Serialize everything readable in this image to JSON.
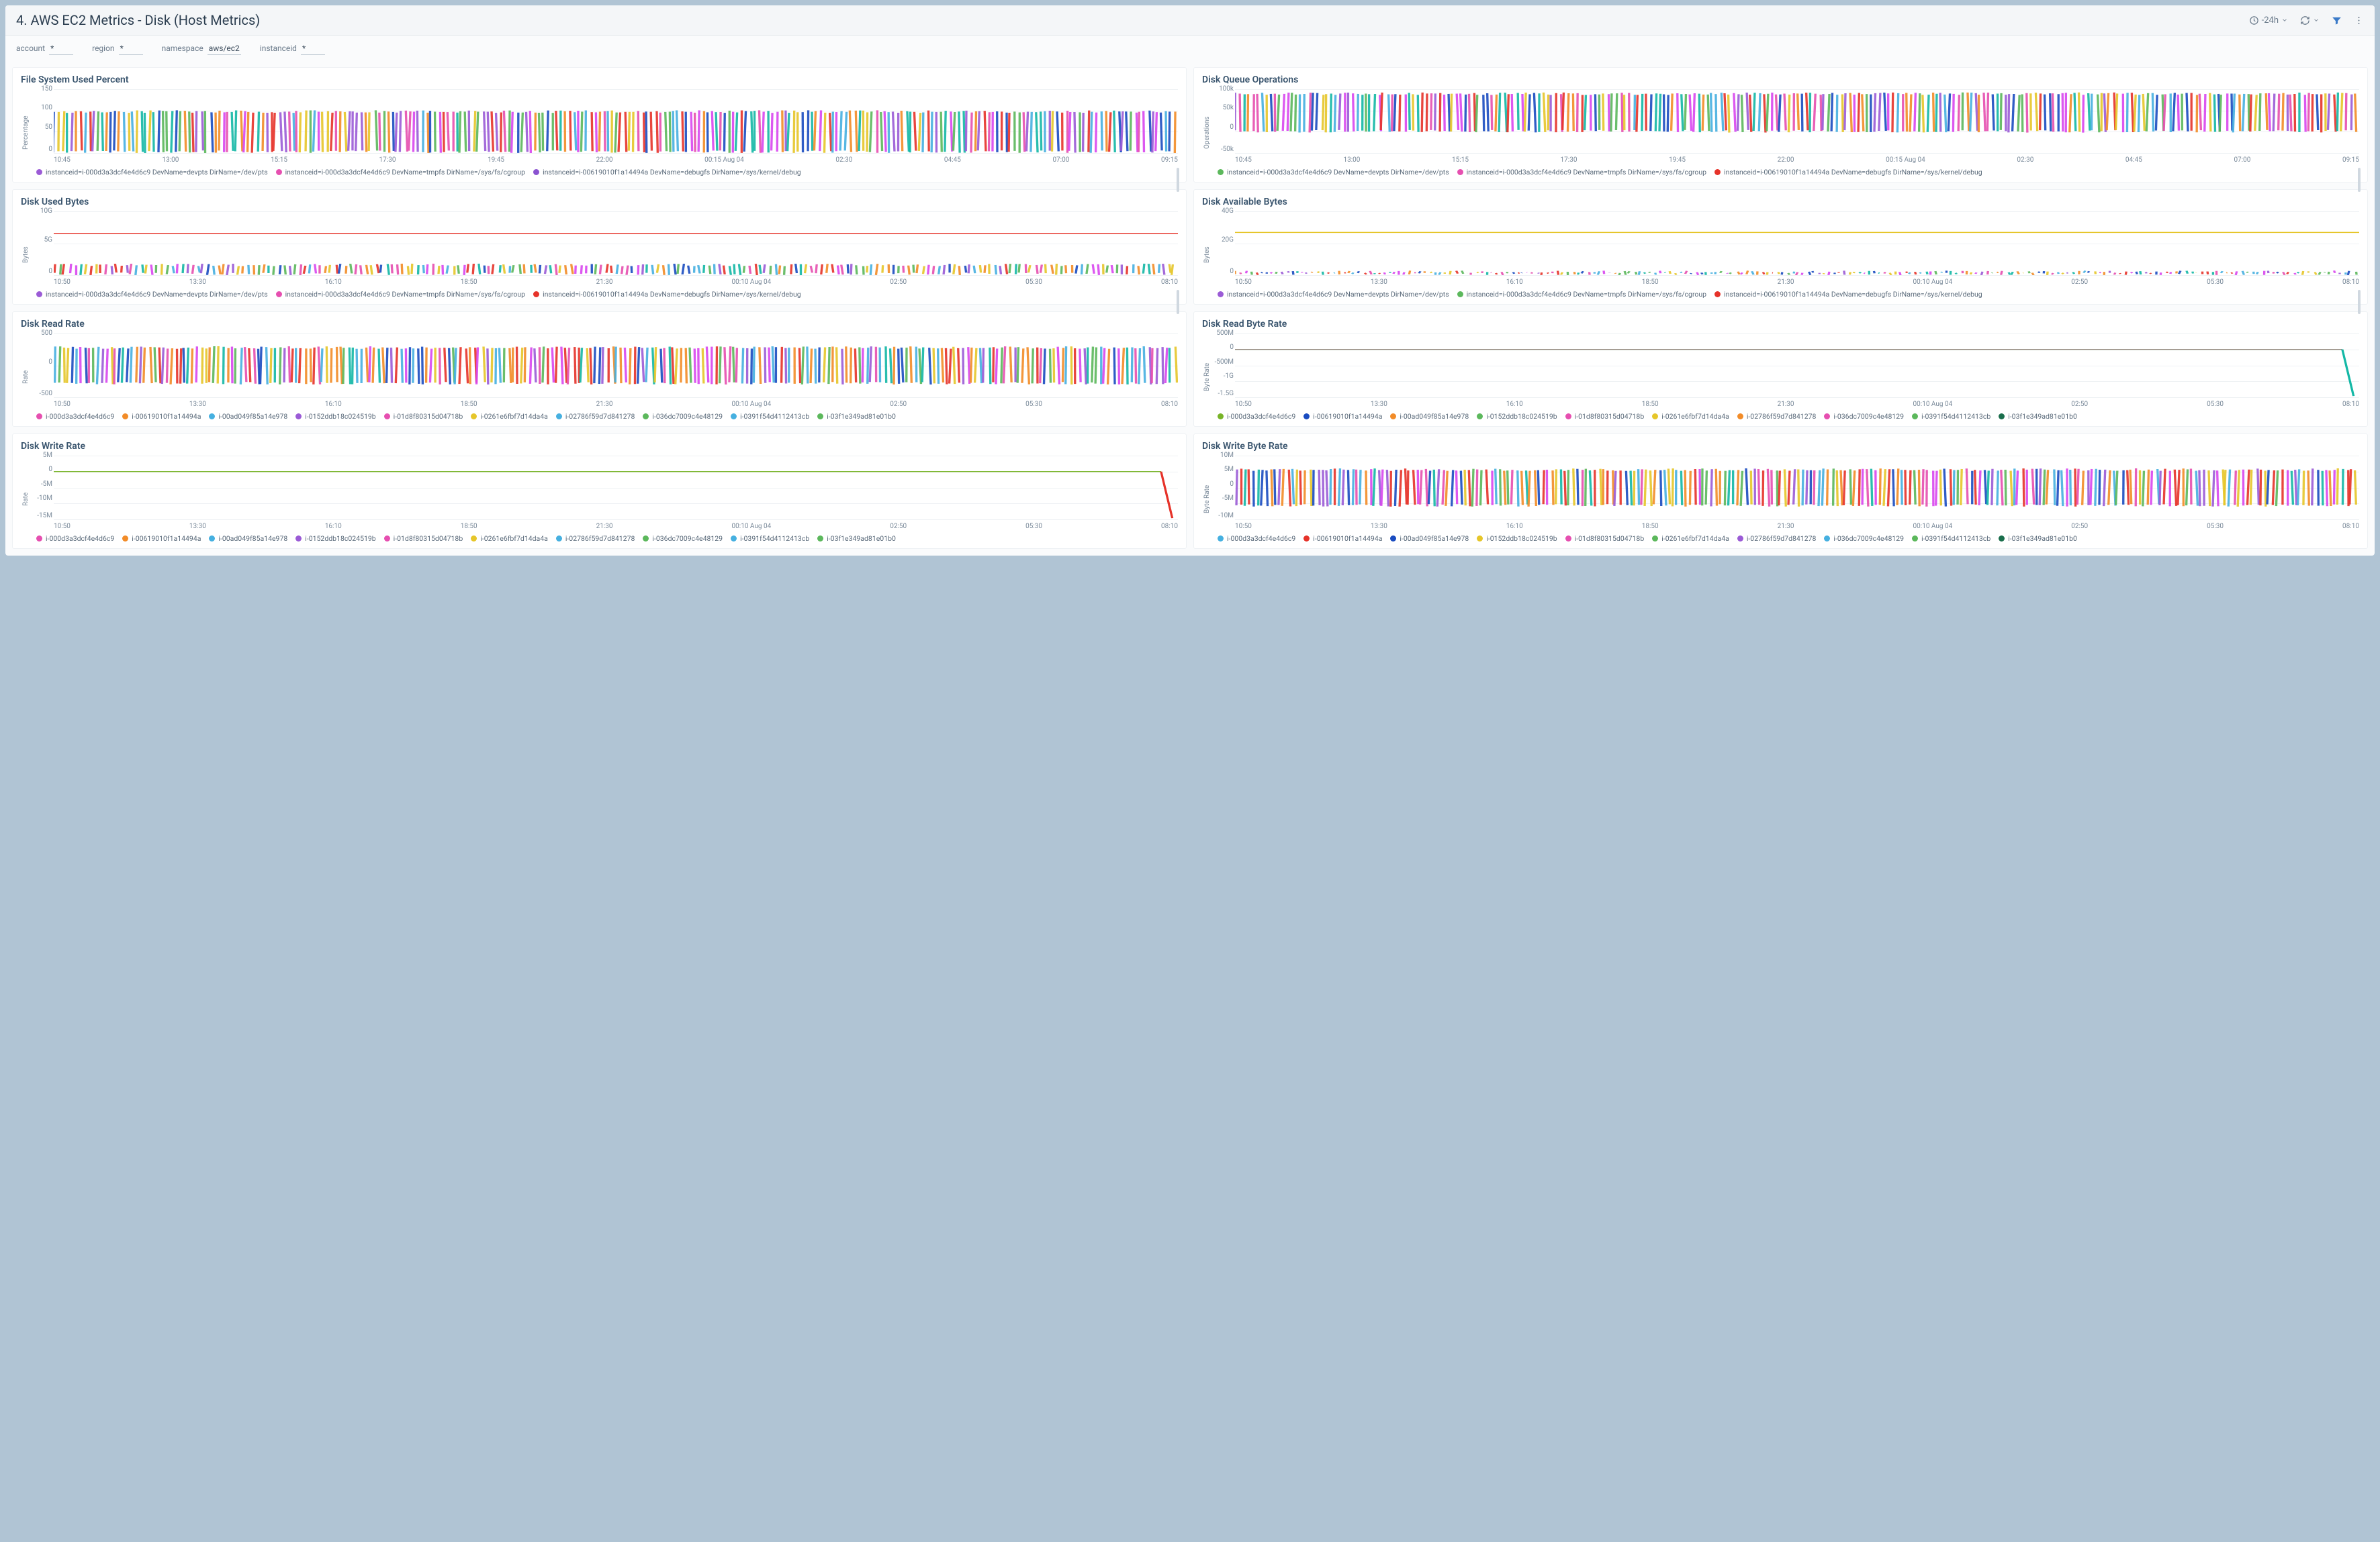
{
  "header": {
    "title": "4. AWS EC2 Metrics - Disk (Host Metrics)",
    "time_range": "-24h"
  },
  "filters": [
    {
      "label": "account",
      "value": "*"
    },
    {
      "label": "region",
      "value": "*"
    },
    {
      "label": "namespace",
      "value": "aws/ec2"
    },
    {
      "label": "instanceid",
      "value": "*"
    }
  ],
  "x_ticks_a": [
    "10:45",
    "13:00",
    "15:15",
    "17:30",
    "19:45",
    "22:00",
    "00:15 Aug 04",
    "02:30",
    "04:45",
    "07:00",
    "09:15"
  ],
  "x_ticks_b": [
    "10:50",
    "13:30",
    "16:10",
    "18:50",
    "21:30",
    "00:10 Aug 04",
    "02:50",
    "05:30",
    "08:10"
  ],
  "legend_long": [
    {
      "label": "instanceid=i-000d3a3dcf4e4d6c9 DevName=devpts DirName=/dev/pts",
      "color": "#9b5bd6"
    },
    {
      "label": "instanceid=i-000d3a3dcf4e4d6c9 DevName=tmpfs DirName=/sys/fs/cgroup",
      "color": "#e64fb0"
    },
    {
      "label": "instanceid=i-00619010f1a14494a DevName=debugfs DirName=/sys/kernel/debug",
      "color": "#8a52d0"
    }
  ],
  "legend_long_alt": [
    {
      "label": "instanceid=i-000d3a3dcf4e4d6c9 DevName=devpts DirName=/dev/pts",
      "color": "#5cb85c"
    },
    {
      "label": "instanceid=i-000d3a3dcf4e4d6c9 DevName=tmpfs DirName=/sys/fs/cgroup",
      "color": "#e64fb0"
    },
    {
      "label": "instanceid=i-00619010f1a14494a DevName=debugfs DirName=/sys/kernel/debug",
      "color": "#e6332a"
    }
  ],
  "legend_long_alt2": [
    {
      "label": "instanceid=i-000d3a3dcf4e4d6c9 DevName=devpts DirName=/dev/pts",
      "color": "#9b5bd6"
    },
    {
      "label": "instanceid=i-000d3a3dcf4e4d6c9 DevName=tmpfs DirName=/sys/fs/cgroup",
      "color": "#5cb85c"
    },
    {
      "label": "instanceid=i-00619010f1a14494a DevName=debugfs DirName=/sys/kernel/debug",
      "color": "#e6332a"
    }
  ],
  "legend_long_alt3": [
    {
      "label": "instanceid=i-000d3a3dcf4e4d6c9 DevName=devpts DirName=/dev/pts",
      "color": "#9b5bd6"
    },
    {
      "label": "instanceid=i-000d3a3dcf4e4d6c9 DevName=tmpfs DirName=/sys/fs/cgroup",
      "color": "#e64fb0"
    },
    {
      "label": "instanceid=i-00619010f1a14494a DevName=debugfs DirName=/sys/kernel/debug",
      "color": "#e6332a"
    }
  ],
  "legend_instances_a": [
    {
      "label": "i-000d3a3dcf4e4d6c9",
      "color": "#e64fb0"
    },
    {
      "label": "i-00619010f1a14494a",
      "color": "#f28c28"
    },
    {
      "label": "i-00ad049f85a14e978",
      "color": "#46b0e0"
    },
    {
      "label": "i-0152ddb18c024519b",
      "color": "#9b5bd6"
    },
    {
      "label": "i-01d8f80315d04718b",
      "color": "#e64fb0"
    },
    {
      "label": "i-0261e6fbf7d14da4a",
      "color": "#e6c62a"
    },
    {
      "label": "i-02786f59d7d841278",
      "color": "#46b0e0"
    },
    {
      "label": "i-036dc7009c4e48129",
      "color": "#5cb85c"
    },
    {
      "label": "i-0391f54d4112413cb",
      "color": "#46b0e0"
    },
    {
      "label": "i-03f1e349ad81e01b0",
      "color": "#5cb85c"
    }
  ],
  "legend_instances_b": [
    {
      "label": "i-000d3a3dcf4e4d6c9",
      "color": "#78b428"
    },
    {
      "label": "i-00619010f1a14494a",
      "color": "#1a4cc0"
    },
    {
      "label": "i-00ad049f85a14e978",
      "color": "#f28c28"
    },
    {
      "label": "i-0152ddb18c024519b",
      "color": "#5cb85c"
    },
    {
      "label": "i-01d8f80315d04718b",
      "color": "#e64fb0"
    },
    {
      "label": "i-0261e6fbf7d14da4a",
      "color": "#e6c62a"
    },
    {
      "label": "i-02786f59d7d841278",
      "color": "#f28c28"
    },
    {
      "label": "i-036dc7009c4e48129",
      "color": "#e64fb0"
    },
    {
      "label": "i-0391f54d4112413cb",
      "color": "#5cb85c"
    },
    {
      "label": "i-03f1e349ad81e01b0",
      "color": "#1a6e4c"
    }
  ],
  "legend_instances_c": [
    {
      "label": "i-000d3a3dcf4e4d6c9",
      "color": "#46b0e0"
    },
    {
      "label": "i-00619010f1a14494a",
      "color": "#e6332a"
    },
    {
      "label": "i-00ad049f85a14e978",
      "color": "#1a4cc0"
    },
    {
      "label": "i-0152ddb18c024519b",
      "color": "#e6c62a"
    },
    {
      "label": "i-01d8f80315d04718b",
      "color": "#e64fb0"
    },
    {
      "label": "i-0261e6fbf7d14da4a",
      "color": "#5cb85c"
    },
    {
      "label": "i-02786f59d7d841278",
      "color": "#9b5bd6"
    },
    {
      "label": "i-036dc7009c4e48129",
      "color": "#46b0e0"
    },
    {
      "label": "i-0391f54d4112413cb",
      "color": "#5cb85c"
    },
    {
      "label": "i-03f1e349ad81e01b0",
      "color": "#1a6e4c"
    }
  ],
  "panels": [
    {
      "id": "fs_used_pct",
      "title": "File System Used Percent",
      "ylabel": "Percentage",
      "yticks": [
        "150",
        "100",
        "50",
        "0"
      ],
      "xticks": "a",
      "style": "dense",
      "legend": "legend_long",
      "scrollbar": true
    },
    {
      "id": "disk_queue",
      "title": "Disk Queue Operations",
      "ylabel": "Operations",
      "yticks": [
        "100k",
        "50k",
        "0",
        "-50k"
      ],
      "xticks": "a",
      "style": "dense_top",
      "legend": "legend_long_alt",
      "scrollbar": true
    },
    {
      "id": "disk_used_bytes",
      "title": "Disk Used Bytes",
      "ylabel": "Bytes",
      "yticks": [
        "10G",
        "5G",
        "0"
      ],
      "xticks": "b",
      "style": "band_low_red",
      "legend": "legend_long_alt3",
      "scrollbar": true
    },
    {
      "id": "disk_avail_bytes",
      "title": "Disk Available Bytes",
      "ylabel": "Bytes",
      "yticks": [
        "40G",
        "20G",
        "0"
      ],
      "xticks": "b",
      "style": "band_low_yellow",
      "legend": "legend_long_alt2",
      "scrollbar": true
    },
    {
      "id": "disk_read_rate",
      "title": "Disk Read Rate",
      "ylabel": "Rate",
      "yticks": [
        "500",
        "0",
        "-500"
      ],
      "xticks": "b",
      "style": "dense_center",
      "legend": "legend_instances_a"
    },
    {
      "id": "disk_read_byte_rate",
      "title": "Disk Read Byte Rate",
      "ylabel": "Byte Rate",
      "yticks": [
        "500M",
        "0",
        "-500M",
        "-1G",
        "-1.5G"
      ],
      "xticks": "b",
      "style": "flat_drop",
      "legend": "legend_instances_b"
    },
    {
      "id": "disk_write_rate",
      "title": "Disk Write Rate",
      "ylabel": "Rate",
      "yticks": [
        "5M",
        "0",
        "-5M",
        "-10M",
        "-15M"
      ],
      "xticks": "b",
      "style": "flat_drop_red",
      "legend": "legend_instances_a"
    },
    {
      "id": "disk_write_byte_rate",
      "title": "Disk Write Byte Rate",
      "ylabel": "Byte Rate",
      "yticks": [
        "10M",
        "5M",
        "0",
        "-5M",
        "-10M"
      ],
      "xticks": "b",
      "style": "dense_center",
      "legend": "legend_instances_c"
    }
  ],
  "chart_data": [
    {
      "id": "fs_used_pct",
      "type": "line",
      "title": "File System Used Percent",
      "ylabel": "Percentage",
      "ylim": [
        0,
        150
      ],
      "x_range": [
        "10:45 Aug 03",
        "09:15 Aug 04"
      ],
      "data_note": "Many overlapping series fluctuating densely between ~0 and ~100 across the full window",
      "series_example": {
        "name": "instanceid=i-000d3a3dcf4e4d6c9 DevName=devpts DirName=/dev/pts",
        "approx_min": 0,
        "approx_max": 100
      }
    },
    {
      "id": "disk_queue",
      "type": "line",
      "title": "Disk Queue Operations",
      "ylabel": "Operations",
      "ylim": [
        -50000,
        100000
      ],
      "x_range": [
        "10:45 Aug 03",
        "09:15 Aug 04"
      ],
      "data_note": "Dense noise between ~0 and ~95k across the window"
    },
    {
      "id": "disk_used_bytes",
      "type": "line",
      "title": "Disk Used Bytes",
      "ylabel": "Bytes",
      "ylim": [
        0,
        10000000000
      ],
      "x_range": [
        "10:50 Aug 03",
        "08:10 Aug 04"
      ],
      "data_note": "Flat red line ~6.5G; dense multi-color band 0–1.5G"
    },
    {
      "id": "disk_avail_bytes",
      "type": "line",
      "title": "Disk Available Bytes",
      "ylabel": "Bytes",
      "ylim": [
        0,
        40000000000
      ],
      "x_range": [
        "10:50 Aug 03",
        "08:10 Aug 04"
      ],
      "data_note": "Flat yellow line ~27G; thin multi-color band near 0–2G"
    },
    {
      "id": "disk_read_rate",
      "type": "line",
      "title": "Disk Read Rate",
      "ylabel": "Rate",
      "ylim": [
        -500,
        500
      ],
      "x_range": [
        "10:50 Aug 03",
        "08:10 Aug 04"
      ],
      "data_note": "Dense noise roughly ±300 across window"
    },
    {
      "id": "disk_read_byte_rate",
      "type": "line",
      "title": "Disk Read Byte Rate",
      "ylabel": "Byte Rate",
      "ylim": [
        -1500000000,
        500000000
      ],
      "x_range": [
        "10:50 Aug 03",
        "08:10 Aug 04"
      ],
      "data_note": "Flat ~0 with sharp teal drop to ~-1.5G at far right"
    },
    {
      "id": "disk_write_rate",
      "type": "line",
      "title": "Disk Write Rate",
      "ylabel": "Rate",
      "ylim": [
        -15000000,
        5000000
      ],
      "x_range": [
        "10:50 Aug 03",
        "08:10 Aug 04"
      ],
      "data_note": "Flat ~0 with sharp red drop to ~-15M at far right"
    },
    {
      "id": "disk_write_byte_rate",
      "type": "line",
      "title": "Disk Write Byte Rate",
      "ylabel": "Byte Rate",
      "ylim": [
        -10000000,
        10000000
      ],
      "x_range": [
        "10:50 Aug 03",
        "08:10 Aug 04"
      ],
      "data_note": "Dense noise roughly ±5M across window"
    }
  ]
}
